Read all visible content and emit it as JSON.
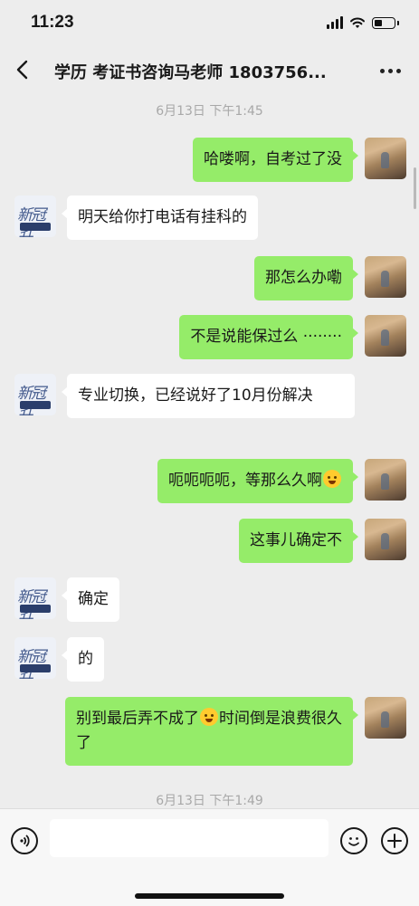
{
  "status": {
    "time": "11:23"
  },
  "header": {
    "title": "学历 考证书咨询马老师 1803756..."
  },
  "timestamps": {
    "top": "6月13日 下午1:45",
    "bottom": "6月13日 下午1:49"
  },
  "messages": [
    {
      "sender": "self",
      "text": "哈喽啊，自考过了没"
    },
    {
      "sender": "other",
      "text": "明天给你打电话有挂科的"
    },
    {
      "sender": "self",
      "text": "那怎么办嘞"
    },
    {
      "sender": "self",
      "text": "不是说能保过么 ········"
    },
    {
      "sender": "other",
      "text": "专业切换，已经说好了10月份解决"
    },
    {
      "sender": "self",
      "text": "呃呃呃呃，等那么久啊",
      "emoji": "crying-face-emoji"
    },
    {
      "sender": "self",
      "text": "这事儿确定不"
    },
    {
      "sender": "other",
      "text": "确定"
    },
    {
      "sender": "other",
      "text": "的"
    },
    {
      "sender": "self",
      "text_before": "别到最后弄不成了",
      "emoji": "laughing-crying-emoji",
      "text_after": "时间倒是浪费很久了"
    }
  ],
  "input": {
    "value": "",
    "placeholder": ""
  },
  "colors": {
    "self_bubble": "#95ec69",
    "other_bubble": "#ffffff",
    "background": "#ededed"
  }
}
